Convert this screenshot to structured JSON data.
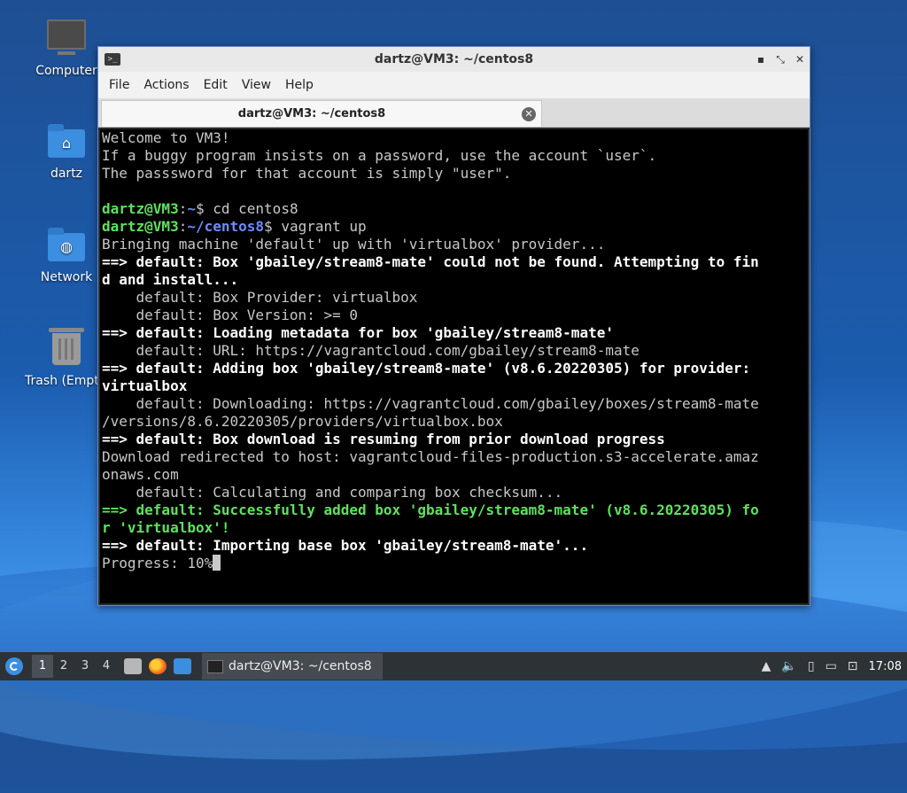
{
  "desktop": {
    "icons": [
      {
        "label": "Computer",
        "icon": "computer-icon"
      },
      {
        "label": "dartz",
        "icon": "home-folder-icon"
      },
      {
        "label": "Network",
        "icon": "network-folder-icon"
      },
      {
        "label": "Trash (Empt",
        "icon": "trash-icon"
      }
    ]
  },
  "window": {
    "title": "dartz@VM3: ~/centos8",
    "controls": {
      "minimize": "▪",
      "maximize": "⤡",
      "close": "✕"
    },
    "menu": [
      "File",
      "Edit",
      "View",
      "Help"
    ],
    "menu_actions": "Actions",
    "tab_label": "dartz@VM3: ~/centos8",
    "tab_close": "✕"
  },
  "terminal": {
    "welcome": [
      "Welcome to VM3!",
      "If a buggy program insists on a password, use the account `user`.",
      "The passsword for that account is simply \"user\"."
    ],
    "prompt1": {
      "user": "dartz@VM3",
      "sep": ":",
      "path": "~",
      "cmd": "$ cd centos8"
    },
    "prompt2": {
      "user": "dartz@VM3",
      "sep": ":",
      "path": "~/centos8",
      "cmd": "$ vagrant up"
    },
    "lines": [
      "Bringing machine 'default' up with 'virtualbox' provider...",
      "==> default: Box 'gbailey/stream8-mate' could not be found. Attempting to fin",
      "d and install...",
      "    default: Box Provider: virtualbox",
      "    default: Box Version: >= 0",
      "==> default: Loading metadata for box 'gbailey/stream8-mate'",
      "    default: URL: https://vagrantcloud.com/gbailey/stream8-mate",
      "==> default: Adding box 'gbailey/stream8-mate' (v8.6.20220305) for provider:",
      "virtualbox",
      "    default: Downloading: https://vagrantcloud.com/gbailey/boxes/stream8-mate",
      "/versions/8.6.20220305/providers/virtualbox.box",
      "==> default: Box download is resuming from prior download progress",
      "Download redirected to host: vagrantcloud-files-production.s3-accelerate.amaz",
      "onaws.com",
      "    default: Calculating and comparing box checksum...",
      "==> default: Successfully added box 'gbailey/stream8-mate' (v8.6.20220305) fo",
      "r 'virtualbox'!",
      "==> default: Importing base box 'gbailey/stream8-mate'...",
      "Progress: 10%"
    ]
  },
  "taskbar": {
    "workspaces": [
      "1",
      "2",
      "3",
      "4"
    ],
    "task_label": "dartz@VM3: ~/centos8",
    "clock": "17:08"
  }
}
